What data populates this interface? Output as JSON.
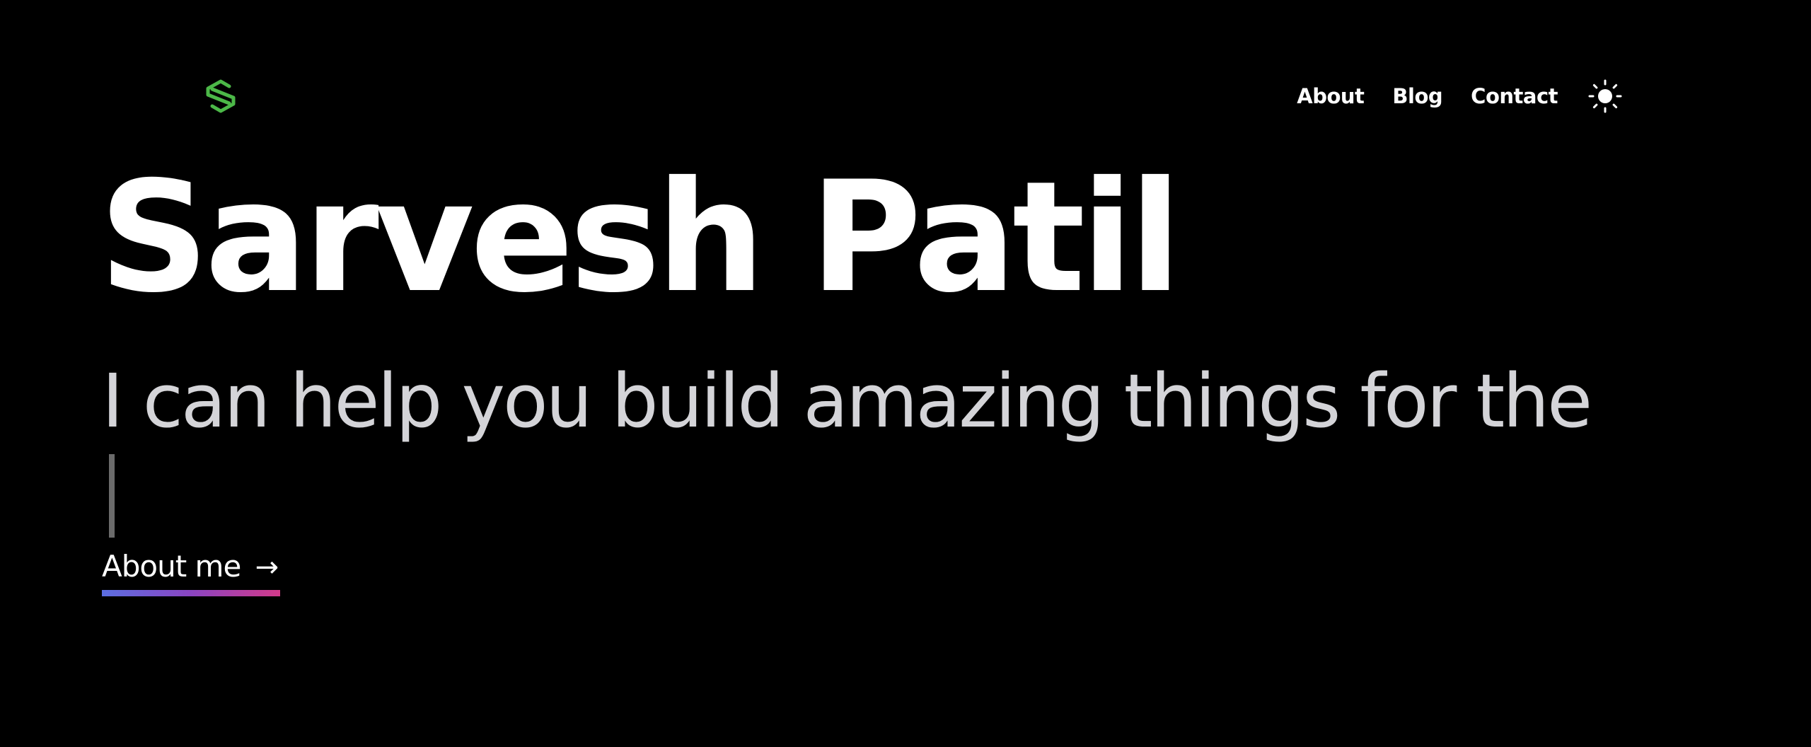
{
  "brand": {
    "logo_icon": "s-hexagon-logo-icon",
    "logo_color": "#4cb848"
  },
  "nav": {
    "items": [
      {
        "label": "About"
      },
      {
        "label": "Blog"
      },
      {
        "label": "Contact"
      }
    ],
    "theme_toggle_icon": "sun-icon"
  },
  "hero": {
    "name": "Sarvesh Patil",
    "tagline": "I can help you build amazing things for the",
    "cta_label": "About me",
    "cta_arrow": "→"
  },
  "colors": {
    "background": "#000000",
    "text": "#ffffff",
    "tagline": "#d4d4d8",
    "gradient_start": "#5b6ee1",
    "gradient_end": "#d23a8a"
  }
}
